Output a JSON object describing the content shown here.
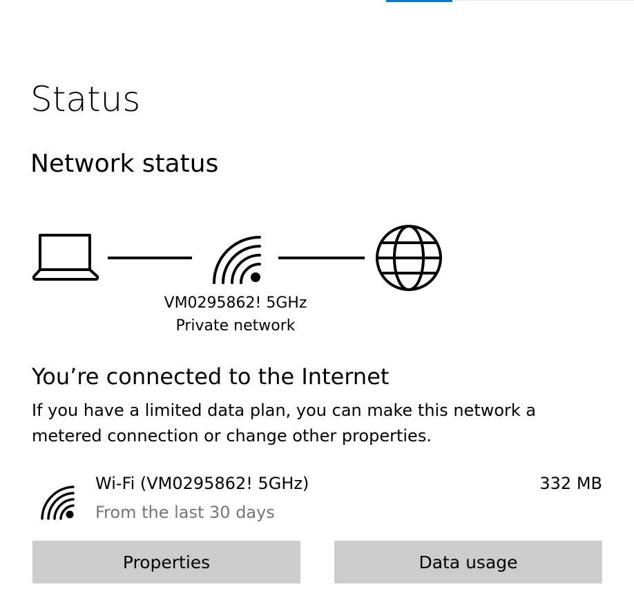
{
  "page": {
    "title": "Status",
    "accent_color": "#0078d7"
  },
  "network_status": {
    "heading": "Network status",
    "diagram": {
      "device_icon": "laptop-icon",
      "network_icon": "wifi-icon",
      "internet_icon": "globe-icon",
      "network_name": "VM0295862! 5GHz",
      "network_type": "Private network"
    }
  },
  "connection": {
    "heading": "You’re connected to the Internet",
    "description": "If you have a limited data plan, you can make this network a metered connection or change other properties."
  },
  "adapter": {
    "icon": "wifi-icon",
    "name": "Wi-Fi (VM0295862! 5GHz)",
    "subtitle": "From the last 30 days",
    "usage": "332 MB"
  },
  "buttons": {
    "properties": "Properties",
    "data_usage": "Data usage",
    "background": "#cccccc"
  },
  "colors": {
    "secondary_text": "#767676"
  }
}
